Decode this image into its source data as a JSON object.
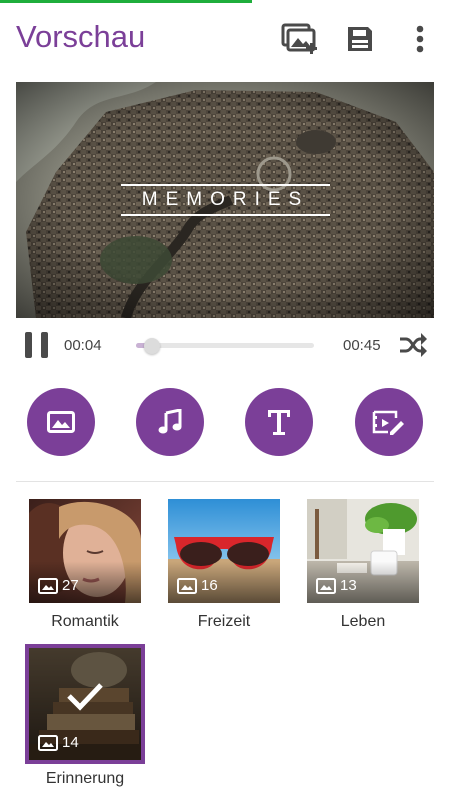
{
  "header": {
    "title": "Vorschau",
    "actions": [
      {
        "name": "add-media-icon"
      },
      {
        "name": "save-icon"
      },
      {
        "name": "more-options-icon"
      }
    ]
  },
  "loading_progress": 0.56,
  "preview": {
    "overlay_text": "MEMORIES"
  },
  "player": {
    "current_time": "00:04",
    "total_time": "00:45",
    "progress": 0.09
  },
  "tools": [
    {
      "name": "image-icon"
    },
    {
      "name": "music-icon"
    },
    {
      "name": "text-icon"
    },
    {
      "name": "edit-video-icon"
    }
  ],
  "categories": [
    {
      "label": "Romantik",
      "count": "27",
      "selected": false
    },
    {
      "label": "Freizeit",
      "count": "16",
      "selected": false
    },
    {
      "label": "Leben",
      "count": "13",
      "selected": false
    },
    {
      "label": "Erinnerung",
      "count": "14",
      "selected": true
    }
  ],
  "colors": {
    "accent": "#7b3f98",
    "progress_line": "#1fae3c"
  }
}
